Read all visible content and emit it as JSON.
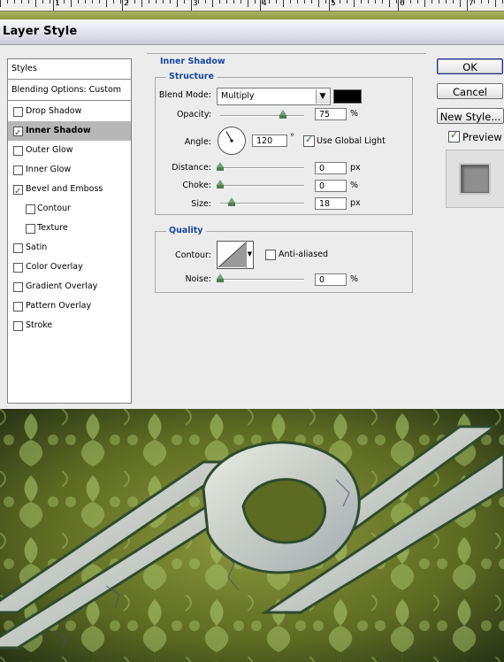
{
  "ruler": {
    "numbers": [
      "1",
      "2",
      "3",
      "4",
      "5",
      "6",
      "7"
    ]
  },
  "window": {
    "title": "Layer Style"
  },
  "styles_panel": {
    "header": "Styles",
    "blending": "Blending Options: Custom",
    "items": [
      {
        "label": "Drop Shadow",
        "checked": false
      },
      {
        "label": "Inner Shadow",
        "checked": true,
        "selected": true
      },
      {
        "label": "Outer Glow",
        "checked": false
      },
      {
        "label": "Inner Glow",
        "checked": false
      },
      {
        "label": "Bevel and Emboss",
        "checked": true
      },
      {
        "label": "Contour",
        "checked": false,
        "indent": true
      },
      {
        "label": "Texture",
        "checked": false,
        "indent": true
      },
      {
        "label": "Satin",
        "checked": false
      },
      {
        "label": "Color Overlay",
        "checked": false
      },
      {
        "label": "Gradient Overlay",
        "checked": false
      },
      {
        "label": "Pattern Overlay",
        "checked": false
      },
      {
        "label": "Stroke",
        "checked": false
      }
    ]
  },
  "inner_shadow": {
    "section_title": "Inner Shadow",
    "structure": {
      "title": "Structure",
      "blend_mode_label": "Blend Mode:",
      "blend_mode_value": "Multiply",
      "shadow_color": "#000000",
      "opacity_label": "Opacity:",
      "opacity_value": "75",
      "opacity_unit": "%",
      "opacity_fraction": 0.75,
      "angle_label": "Angle:",
      "angle_value": "120",
      "angle_unit": "°",
      "use_global_light_label": "Use Global Light",
      "use_global_light_checked": true,
      "distance_label": "Distance:",
      "distance_value": "0",
      "distance_unit": "px",
      "choke_label": "Choke:",
      "choke_value": "0",
      "choke_unit": "%",
      "size_label": "Size:",
      "size_value": "18",
      "size_unit": "px"
    },
    "quality": {
      "title": "Quality",
      "contour_label": "Contour:",
      "anti_aliased_label": "Anti-aliased",
      "anti_aliased_checked": false,
      "noise_label": "Noise:",
      "noise_value": "0",
      "noise_unit": "%"
    }
  },
  "buttons": {
    "ok": "OK",
    "cancel": "Cancel",
    "new_style": "New Style...",
    "preview_label": "Preview",
    "preview_checked": true
  },
  "colors": {
    "section_title": "#16489c",
    "artwork_green": "#5d6b22",
    "pattern_green": "#a9c46a"
  }
}
